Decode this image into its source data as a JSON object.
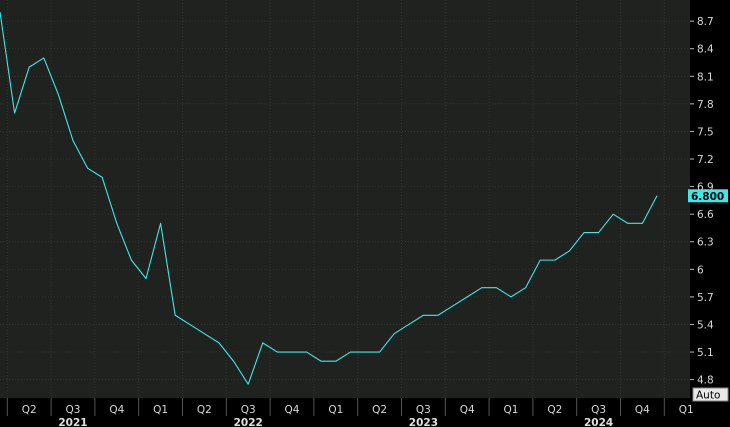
{
  "chart_data": {
    "type": "line",
    "line_color": "#3ee8e8",
    "background": "#1f221f",
    "grid": true,
    "ylim": [
      4.6,
      8.93
    ],
    "y_ticks": [
      "4.8",
      "5.1",
      "5.4",
      "5.7",
      "6",
      "6.3",
      "6.6",
      "6.9",
      "7.2",
      "7.5",
      "7.8",
      "8.1",
      "8.4",
      "8.7"
    ],
    "last_value_label": "6.800",
    "autoscale_label": "Auto",
    "x_quarter_labels": [
      {
        "label": "Q2",
        "t": 2
      },
      {
        "label": "Q3",
        "t": 5
      },
      {
        "label": "Q4",
        "t": 8
      },
      {
        "label": "Q1",
        "t": 11
      },
      {
        "label": "Q2",
        "t": 14
      },
      {
        "label": "Q3",
        "t": 17
      },
      {
        "label": "Q4",
        "t": 20
      },
      {
        "label": "Q1",
        "t": 23
      },
      {
        "label": "Q2",
        "t": 26
      },
      {
        "label": "Q3",
        "t": 29
      },
      {
        "label": "Q4",
        "t": 32
      },
      {
        "label": "Q1",
        "t": 35
      },
      {
        "label": "Q2",
        "t": 38
      },
      {
        "label": "Q3",
        "t": 41
      },
      {
        "label": "Q4",
        "t": 44
      },
      {
        "label": "Q1",
        "t": 47
      }
    ],
    "x_year_labels": [
      {
        "label": "2021",
        "t": 5
      },
      {
        "label": "2022",
        "t": 17
      },
      {
        "label": "2023",
        "t": 29
      },
      {
        "label": "2024",
        "t": 41
      }
    ],
    "values": [
      8.8,
      7.7,
      8.2,
      8.3,
      7.9,
      7.4,
      7.1,
      7.0,
      6.5,
      6.1,
      5.9,
      6.5,
      5.5,
      5.4,
      5.3,
      5.2,
      5.0,
      4.75,
      5.2,
      5.1,
      5.1,
      5.1,
      5.0,
      5.0,
      5.1,
      5.1,
      5.1,
      5.3,
      5.4,
      5.5,
      5.5,
      5.6,
      5.7,
      5.8,
      5.8,
      5.7,
      5.8,
      6.1,
      6.1,
      6.2,
      6.4,
      6.4,
      6.6,
      6.5,
      6.5,
      6.8
    ]
  }
}
